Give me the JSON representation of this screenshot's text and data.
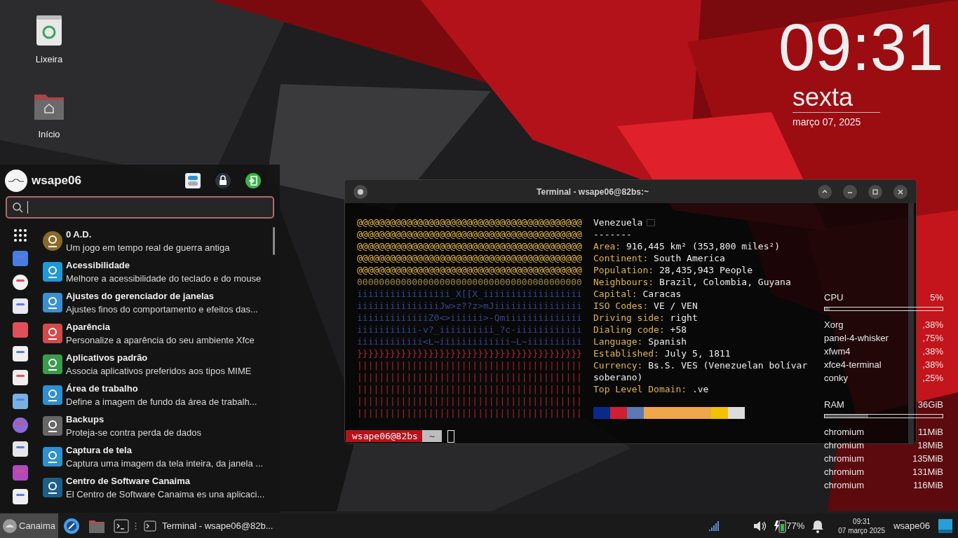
{
  "desktop_icons": [
    {
      "label": "Lixeira"
    },
    {
      "label": "Início"
    }
  ],
  "clock": {
    "time": "09:31",
    "weekday": "sexta",
    "date": "março 07, 2025"
  },
  "menu": {
    "user": "wsape06",
    "items": [
      {
        "name": "0 A.D.",
        "description": "Um jogo em tempo real de guerra antiga"
      },
      {
        "name": "Acessibilidade",
        "description": "Melhore a acessibilidade do teclado e do mouse"
      },
      {
        "name": "Ajustes do gerenciador de janelas",
        "description": "Ajustes finos do comportamento e efeitos das..."
      },
      {
        "name": "Aparência",
        "description": "Personalize a aparência do seu ambiente Xfce"
      },
      {
        "name": "Aplicativos padrão",
        "description": "Associa aplicativos preferidos aos tipos MIME"
      },
      {
        "name": "Área de trabalho",
        "description": "Define a imagem de fundo da área de trabalh..."
      },
      {
        "name": "Backups",
        "description": "Proteja-se contra perda de dados"
      },
      {
        "name": "Captura de tela",
        "description": "Captura uma imagem da tela inteira, da janela ..."
      },
      {
        "name": "Centro de Software Canaima",
        "description": "El Centro de Software Canaima es una aplicaci..."
      }
    ]
  },
  "conky": {
    "cpu": {
      "label": "CPU",
      "value": "5%",
      "level": 0.04
    },
    "cpu_processes": [
      {
        "name": "Xorg",
        "value": ",38%"
      },
      {
        "name": "panel-4-whisker",
        "value": ",75%"
      },
      {
        "name": "xfwm4",
        "value": ",38%"
      },
      {
        "name": "xfce4-terminal",
        "value": ",38%"
      },
      {
        "name": "conky",
        "value": ",25%"
      }
    ],
    "ram": {
      "label": "RAM",
      "value": "36GiB",
      "level": 0.37
    },
    "ram_processes": [
      {
        "name": "chromium",
        "value": "11MiB"
      },
      {
        "name": "chromium",
        "value": "18MiB"
      },
      {
        "name": "chromium",
        "value": "135MiB"
      },
      {
        "name": "chromium",
        "value": "131MiB"
      },
      {
        "name": "chromium",
        "value": "116MiB"
      }
    ]
  },
  "terminal": {
    "title": "Terminal - wsape06@82bs:~",
    "art": [
      {
        "text": "@@@@@@@@@@@@@@@@@@@@@@@@@@@@@@@@@@@@@@@@@",
        "color": "#e2b440"
      },
      {
        "text": "@@@@@@@@@@@@@@@@@@@@@@@@@@@@@@@@@@@@@@@@@",
        "color": "#e2b440"
      },
      {
        "text": "@@@@@@@@@@@@@@@@@@@@@@@@@@@@@@@@@@@@@@@@@",
        "color": "#e2b440"
      },
      {
        "text": "@@@@@@@@@@@@@@@@@@@@@@@@@@@@@@@@@@@@@@@@@",
        "color": "#e2b440"
      },
      {
        "text": "@@@@@@@@@@@@@@@@@@@@@@@@@@@@@@@@@@@@@@@@@",
        "color": "#e2b440"
      },
      {
        "text": "00000000000000000000000000000000000000000",
        "color": "#a08a45"
      },
      {
        "text": "iiiiiiiiiiiiiiiii_X[[X_iiiiiiiiiiiiiiiiii",
        "color": "#34478f"
      },
      {
        "text": "iiiiiiiiiiiiiiiJw>z??z>mJiiiiiiiiiiiiiiii",
        "color": "#34478f"
      },
      {
        "text": "iiiiiiiiiiiiiZ0<>iiiiii>-Qmiiiiiiiiiiiiii",
        "color": "#34478f"
      },
      {
        "text": "iiiiiiiiiii-v?_iiiiiiiiii_?c-iiiiiiiiiiii",
        "color": "#34478f"
      },
      {
        "text": "iiiiiiiiiiii<L~iiiiiiiiiiiii~L~iiiiiiiiii",
        "color": "#34478f"
      },
      {
        "text": "}}}}}}}}}}}}}}}}}}}}}}}}}}}}}}}}}}}}}}}}}",
        "color": "#b4243a"
      },
      {
        "text": "|||||||||||||||||||||||||||||||||||||||||",
        "color": "#a8232f"
      },
      {
        "text": "|||||||||||||||||||||||||||||||||||||||||",
        "color": "#a8232f"
      },
      {
        "text": "|||||||||||||||||||||||||||||||||||||||||",
        "color": "#a8232f"
      },
      {
        "text": "|||||||||||||||||||||||||||||||||||||||||",
        "color": "#a8232f"
      },
      {
        "text": "|||||||||||||||||||||||||||||||||||||||||",
        "color": "#a8232f"
      }
    ],
    "country": "Venezuela",
    "separator": "-------",
    "info": [
      {
        "key": "Area:",
        "value": "916,445 km² (353,800 miles²)"
      },
      {
        "key": "Continent:",
        "value": "South America"
      },
      {
        "key": "Population:",
        "value": "28,435,943 People"
      },
      {
        "key": "Neighbours:",
        "value": "Brazil, Colombia, Guyana"
      },
      {
        "key": "Capital:",
        "value": "Caracas"
      },
      {
        "key": "ISO Codes:",
        "value": "VE / VEN"
      },
      {
        "key": "Driving side:",
        "value": "right"
      },
      {
        "key": "Dialing code:",
        "value": "+58"
      },
      {
        "key": "Language:",
        "value": "Spanish"
      },
      {
        "key": "Established:",
        "value": "July 5, 1811"
      },
      {
        "key": "Currency:",
        "value": "Bs.S. VES (Venezuelan bolívar soberano)"
      },
      {
        "key": "Top Level Domain:",
        "value": ".ve"
      }
    ],
    "palette": [
      {
        "color": "#0a2a8a"
      },
      {
        "color": "#cf1f36"
      },
      {
        "color": "#5e78b4"
      },
      {
        "color": "#f0a64a"
      },
      {
        "color": "#f0a64a"
      },
      {
        "color": "#f0a64a"
      },
      {
        "color": "#f0a64a"
      },
      {
        "color": "#f2c200"
      },
      {
        "color": "#dcdcdc"
      }
    ],
    "prompt": {
      "user": "wsape06@82bs",
      "directory": "~"
    }
  },
  "taskbar": {
    "start": "Canaima",
    "task": "Terminal - wsape06@82b...",
    "battery": "77%",
    "time": "09:31",
    "date": "07 março 2025",
    "user": "wsape06"
  }
}
